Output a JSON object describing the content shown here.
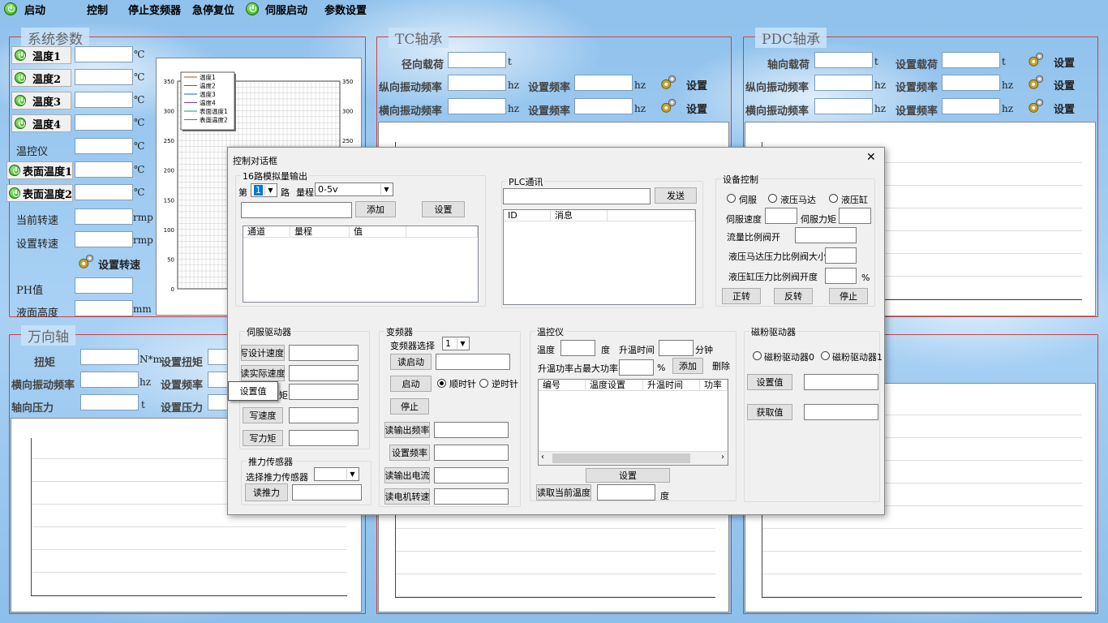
{
  "menu": {
    "start": "启动",
    "control": "控制",
    "stop_vfd": "停止变频器",
    "estop_reset": "急停复位",
    "servo_start": "伺服启动",
    "params": "参数设置"
  },
  "sys": {
    "title": "系统参数",
    "temp1": "温度1",
    "temp2": "温度2",
    "temp3": "温度3",
    "temp4": "温度4",
    "temp_ctrl": "温控仪",
    "surf1": "表面温度1",
    "surf2": "表面温度2",
    "cur_speed": "当前转速",
    "set_speed": "设置转速",
    "set_speed_btn": "设置转速",
    "ph": "PH值",
    "level": "液面高度",
    "unit_c": "℃",
    "unit_rmp": "rmp",
    "unit_mm": "mm"
  },
  "legend": [
    "温度1",
    "温度2",
    "温度3",
    "温度4",
    "表面温度1",
    "表面温度2"
  ],
  "chart_data": {
    "type": "line",
    "series": [
      {
        "name": "温度1",
        "values": []
      },
      {
        "name": "温度2",
        "values": []
      },
      {
        "name": "温度3",
        "values": []
      },
      {
        "name": "温度4",
        "values": []
      },
      {
        "name": "表面温度1",
        "values": []
      },
      {
        "name": "表面温度2",
        "values": []
      }
    ],
    "yticks": [
      "350",
      "300",
      "250",
      "200",
      "150",
      "100",
      "50",
      "0"
    ],
    "ylim": [
      0,
      350
    ],
    "colors": [
      "#c0392b",
      "#3a7d2c",
      "#2a53c1",
      "#6a3fb0",
      "#1a8aa0",
      "#4477aa"
    ]
  },
  "tc": {
    "title": "TC轴承",
    "radial_load": "径向载荷",
    "lon_vib": "纵向振动频率",
    "lat_vib": "横向振动频率",
    "set_freq": "设置频率",
    "set": "设置",
    "unit_t": "t",
    "unit_hz": "hz"
  },
  "pdc": {
    "title": "PDC轴承",
    "axial_load": "轴向载荷",
    "set_load": "设置载荷",
    "lon_vib": "纵向振动频率",
    "lat_vib": "横向振动频率",
    "set_freq": "设置频率",
    "set": "设置",
    "unit_t": "t",
    "unit_hz": "hz"
  },
  "uj": {
    "title": "万向轴",
    "torque": "扭矩",
    "unit_nm": "N*m",
    "set_torque": "设置扭矩",
    "lat_vib": "横向振动频率",
    "unit_hz": "hz",
    "set_freq": "设置频率",
    "axial_p": "轴向压力",
    "unit_t": "t",
    "set_p": "设置压力"
  },
  "dialog": {
    "title": "控制对话框",
    "close": "✕",
    "analog": {
      "legend": "16路模拟量输出",
      "no_label": "第",
      "no_value": "1",
      "route": "路",
      "range_label": "量程",
      "range_value": "0-5v",
      "add": "添加",
      "set": "设置",
      "cols": [
        "通道",
        "量程",
        "值"
      ]
    },
    "plc": {
      "legend": "PLC通讯",
      "send": "发送",
      "cols": [
        "ID",
        "消息"
      ]
    },
    "device": {
      "legend": "设备控制",
      "r_servo": "伺服",
      "r_motor": "液压马达",
      "r_cyl": "液压缸",
      "servo_speed": "伺服速度",
      "servo_torque": "伺服力矩",
      "flow_valve": "流量比例阀开",
      "motor_valve": "液压马达压力比例阀大小",
      "cyl_valve": "液压缸压力比例阀开度",
      "pct": "%",
      "fwd": "正转",
      "rev": "反转",
      "stop": "停止"
    },
    "servo": {
      "legend": "伺服驱动器",
      "set_speed": "写设计速度",
      "read_speed": "读实际速度",
      "torque_tail": "矩",
      "write_speed": "写速度",
      "write_torque": "写力矩"
    },
    "tooltip_setval": "设置值",
    "thrust": {
      "legend": "推力传感器",
      "select": "选择推力传感器",
      "read": "读推力"
    },
    "vfd": {
      "legend": "变频器",
      "select": "变频器选择",
      "select_value": "1",
      "read_start": "读启动",
      "start": "启动",
      "cw": "顺时针",
      "ccw": "逆时针",
      "stop": "停止",
      "read_out_freq": "读输出频率",
      "set_freq": "设置频率",
      "read_out_cur": "读输出电流",
      "read_motor_speed": "读电机转速"
    },
    "tc": {
      "legend": "温控仪",
      "temp": "温度",
      "deg": "度",
      "ramp_time": "升温时间",
      "minutes": "分钟",
      "ramp_power": "升温功率占最大功率",
      "pct": "%",
      "add": "添加",
      "del": "删除",
      "cols": [
        "编号",
        "温度设置",
        "升温时间",
        "功率占"
      ],
      "set": "设置",
      "read_cur": "读取当前温度",
      "deg2": "度"
    },
    "mp": {
      "legend": "磁粉驱动器",
      "d0": "磁粉驱动器0",
      "d1": "磁粉驱动器1",
      "set_val": "设置值",
      "get_val": "获取值"
    }
  }
}
